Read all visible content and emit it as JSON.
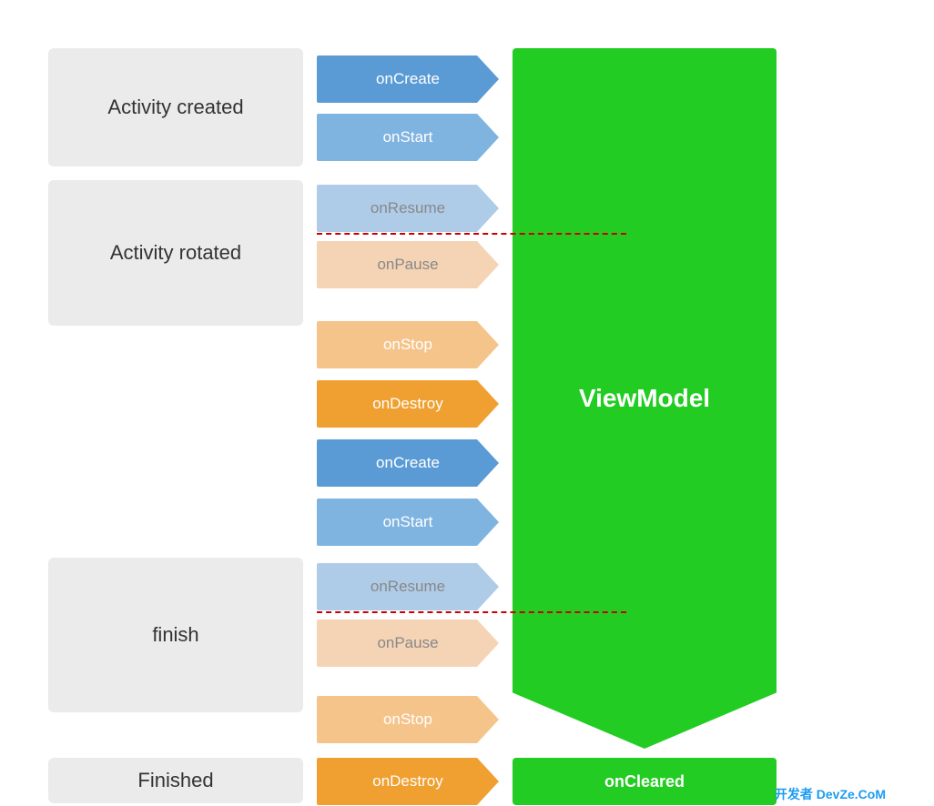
{
  "labels": {
    "activity_created": "Activity created",
    "activity_rotated": "Activity rotated",
    "finish": "finish",
    "finished": "Finished",
    "viewmodel": "ViewModel",
    "oncleared": "onCleared",
    "watermark": "开发者 DevZe.CoM"
  },
  "arrows": [
    {
      "label": "onCreate",
      "color": "#5b9bd5",
      "type": "normal"
    },
    {
      "label": "onStart",
      "color": "#7fb3e0",
      "type": "normal"
    },
    {
      "label": "onResume",
      "color": "#aecce8",
      "type": "light"
    },
    {
      "label": "onPause",
      "color": "#f5d4b5",
      "type": "light"
    },
    {
      "label": "onStop",
      "color": "#f5c48a",
      "type": "medium"
    },
    {
      "label": "onDestroy",
      "color": "#f0a030",
      "type": "strong"
    },
    {
      "label": "onCreate",
      "color": "#5b9bd5",
      "type": "normal"
    },
    {
      "label": "onStart",
      "color": "#7fb3e0",
      "type": "normal"
    },
    {
      "label": "onResume",
      "color": "#aecce8",
      "type": "light"
    },
    {
      "label": "onPause",
      "color": "#f5d4b5",
      "type": "light"
    },
    {
      "label": "onStop",
      "color": "#f5c48a",
      "type": "medium"
    },
    {
      "label": "onDestroy",
      "color": "#f0a030",
      "type": "strong"
    }
  ],
  "colors": {
    "label_bg": "#ebebeb",
    "viewmodel_green": "#22cc22",
    "dashed_red": "#cc0000"
  }
}
